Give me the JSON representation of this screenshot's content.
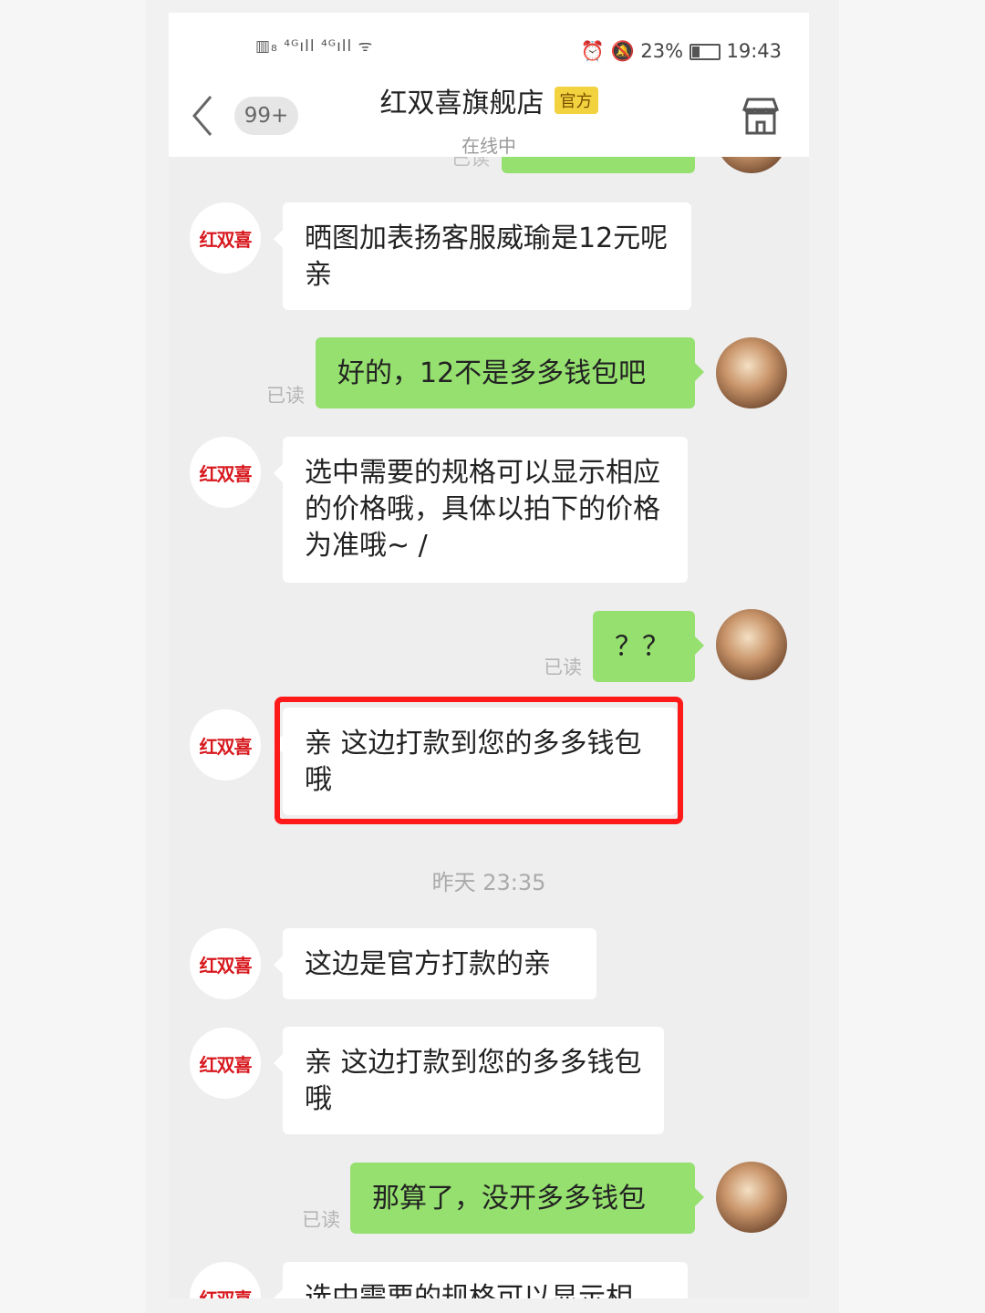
{
  "status_bar": {
    "left_icons": "▥₈ ⁴ᴳıll ⁴ᴳıll ᯤ",
    "right_icons": "⏰ 🔕",
    "battery": "23%",
    "time": "19:43"
  },
  "header": {
    "unread": "99+",
    "title": "红双喜旗舰店",
    "badge": "官方",
    "subtitle": "在线中",
    "shop_logo_text": "红双喜"
  },
  "messages": [
    {
      "from": "shop",
      "text": "晒图加表扬客服威瑜是12元呢亲"
    },
    {
      "from": "me",
      "text": "好的，12不是多多钱包吧",
      "read": "已读"
    },
    {
      "from": "shop",
      "text": "选中需要的规格可以显示相应的价格哦，具体以拍下的价格为准哦~ /"
    },
    {
      "from": "me",
      "text": "？？",
      "read": "已读"
    },
    {
      "from": "shop",
      "text": "亲 这边打款到您的多多钱包哦",
      "highlighted": true
    },
    {
      "type": "time",
      "text": "昨天 23:35"
    },
    {
      "from": "shop",
      "text": "这边是官方打款的亲"
    },
    {
      "from": "shop",
      "text": "亲 这边打款到您的多多钱包哦"
    },
    {
      "from": "me",
      "text": "那算了，没开多多钱包",
      "read": "已读"
    },
    {
      "from": "shop",
      "text": "选中需要的规格可以显示相"
    }
  ],
  "partial_top_read": "已读",
  "colors": {
    "me_bubble": "#95e06f",
    "shop_bubble": "#ffffff",
    "highlight": "#ff1a1a",
    "badge": "#f2d23f"
  }
}
